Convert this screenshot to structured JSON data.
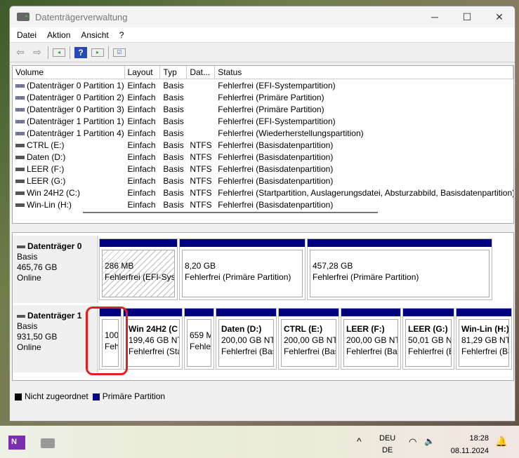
{
  "window": {
    "title": "Datenträgerverwaltung",
    "minimize": "─",
    "maximize": "☐",
    "close": "✕"
  },
  "menu": [
    "Datei",
    "Aktion",
    "Ansicht",
    "?"
  ],
  "toolbar": [
    "back-icon",
    "forward-icon",
    "console-tree-icon",
    "help-icon",
    "action-pane-icon",
    "properties-icon"
  ],
  "list": {
    "columns": [
      "Volume",
      "Layout",
      "Typ",
      "Dat...",
      "Status"
    ],
    "rows": [
      [
        "(Datenträger 0 Partition 1)",
        "Einfach",
        "Basis",
        "",
        "Fehlerfrei (EFI-Systempartition)"
      ],
      [
        "(Datenträger 0 Partition 2)",
        "Einfach",
        "Basis",
        "",
        "Fehlerfrei (Primäre Partition)"
      ],
      [
        "(Datenträger 0 Partition 3)",
        "Einfach",
        "Basis",
        "",
        "Fehlerfrei (Primäre Partition)"
      ],
      [
        "(Datenträger 1 Partition 1)",
        "Einfach",
        "Basis",
        "",
        "Fehlerfrei (EFI-Systempartition)"
      ],
      [
        "(Datenträger 1 Partition 4)",
        "Einfach",
        "Basis",
        "",
        "Fehlerfrei (Wiederherstellungspartition)"
      ],
      [
        "CTRL (E:)",
        "Einfach",
        "Basis",
        "NTFS",
        "Fehlerfrei (Basisdatenpartition)"
      ],
      [
        "Daten (D:)",
        "Einfach",
        "Basis",
        "NTFS",
        "Fehlerfrei (Basisdatenpartition)"
      ],
      [
        "LEER (F:)",
        "Einfach",
        "Basis",
        "NTFS",
        "Fehlerfrei (Basisdatenpartition)"
      ],
      [
        "LEER (G:)",
        "Einfach",
        "Basis",
        "NTFS",
        "Fehlerfrei (Basisdatenpartition)"
      ],
      [
        "Win 24H2 (C:)",
        "Einfach",
        "Basis",
        "NTFS",
        "Fehlerfrei (Startpartition, Auslagerungsdatei, Absturzabbild, Basisdatenpartition)"
      ],
      [
        "Win-Lin (H:)",
        "Einfach",
        "Basis",
        "NTFS",
        "Fehlerfrei (Basisdatenpartition)"
      ]
    ]
  },
  "disks": [
    {
      "name": "Datenträger 0",
      "type": "Basis",
      "size": "465,76 GB",
      "state": "Online",
      "partitions": [
        {
          "title": "",
          "size": "286 MB",
          "status": "Fehlerfrei (EFI-Syst",
          "hatch": true
        },
        {
          "title": "",
          "size": "8,20 GB",
          "status": "Fehlerfrei (Primäre Partition)"
        },
        {
          "title": "",
          "size": "457,28 GB",
          "status": "Fehlerfrei (Primäre Partition)"
        }
      ]
    },
    {
      "name": "Datenträger 1",
      "type": "Basis",
      "size": "931,50 GB",
      "state": "Online",
      "partitions": [
        {
          "title": "",
          "size": "100",
          "status": "Feh"
        },
        {
          "title": "Win 24H2  (C",
          "size": "199,46 GB NTI",
          "status": "Fehlerfrei (Sta"
        },
        {
          "title": "",
          "size": "659 M",
          "status": "Fehle"
        },
        {
          "title": "Daten  (D:)",
          "size": "200,00 GB NTI",
          "status": "Fehlerfrei (Bas"
        },
        {
          "title": "CTRL  (E:)",
          "size": "200,00 GB NTI",
          "status": "Fehlerfrei (Bas"
        },
        {
          "title": "LEER  (F:)",
          "size": "200,00 GB NTI",
          "status": "Fehlerfrei (Bas"
        },
        {
          "title": "LEER  (G:)",
          "size": "50,01 GB NT",
          "status": "Fehlerfrei (B"
        },
        {
          "title": "Win-Lin  (H:)",
          "size": "81,29 GB NTI",
          "status": "Fehlerfrei (Ba"
        }
      ]
    }
  ],
  "legend": [
    {
      "label": "Nicht zugeordnet",
      "color": "#000000"
    },
    {
      "label": "Primäre Partition",
      "color": "#000080"
    }
  ],
  "highlight_color": "#e02020",
  "taskbar": {
    "lang1": "DEU",
    "lang2": "DE",
    "time": "18:28",
    "date": "08.11.2024"
  }
}
